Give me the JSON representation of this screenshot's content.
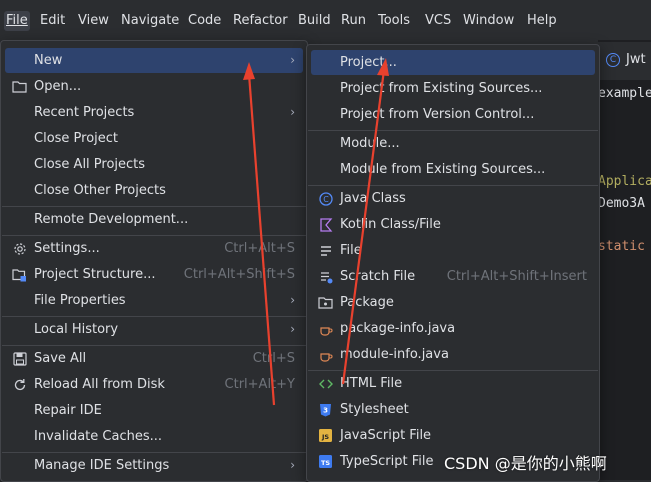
{
  "menubar": {
    "items": [
      "File",
      "Edit",
      "View",
      "Navigate",
      "Code",
      "Refactor",
      "Build",
      "Run",
      "Tools",
      "VCS",
      "Window",
      "Help"
    ]
  },
  "file_menu": {
    "new": "New",
    "open": "Open...",
    "recent_projects": "Recent Projects",
    "close_project": "Close Project",
    "close_all_projects": "Close All Projects",
    "close_other_projects": "Close Other Projects",
    "remote_development": "Remote Development...",
    "settings": "Settings...",
    "settings_shortcut": "Ctrl+Alt+S",
    "project_structure": "Project Structure...",
    "project_structure_shortcut": "Ctrl+Alt+Shift+S",
    "file_properties": "File Properties",
    "local_history": "Local History",
    "save_all": "Save All",
    "save_all_shortcut": "Ctrl+S",
    "reload_all": "Reload All from Disk",
    "reload_all_shortcut": "Ctrl+Alt+Y",
    "repair_ide": "Repair IDE",
    "invalidate_caches": "Invalidate Caches...",
    "manage_ide_settings": "Manage IDE Settings"
  },
  "new_submenu": {
    "project": "Project...",
    "project_existing_sources": "Project from Existing Sources...",
    "project_version_control": "Project from Version Control...",
    "module": "Module...",
    "module_existing_sources": "Module from Existing Sources...",
    "java_class": "Java Class",
    "kotlin_class": "Kotlin Class/File",
    "file": "File",
    "scratch_file": "Scratch File",
    "scratch_file_shortcut": "Ctrl+Alt+Shift+Insert",
    "package": "Package",
    "package_info": "package-info.java",
    "module_info": "module-info.java",
    "html_file": "HTML File",
    "stylesheet": "Stylesheet",
    "javascript_file": "JavaScript File",
    "typescript_file": "TypeScript File"
  },
  "editor": {
    "tab_label": "Jwt",
    "lines": [
      "example",
      "Applicat",
      "Demo3A",
      "static v"
    ]
  },
  "watermark": "CSDN @是你的小熊啊",
  "colors": {
    "background": "#2b2d30",
    "selection": "#2e436e",
    "annotation_arrow": "#e8412e"
  }
}
